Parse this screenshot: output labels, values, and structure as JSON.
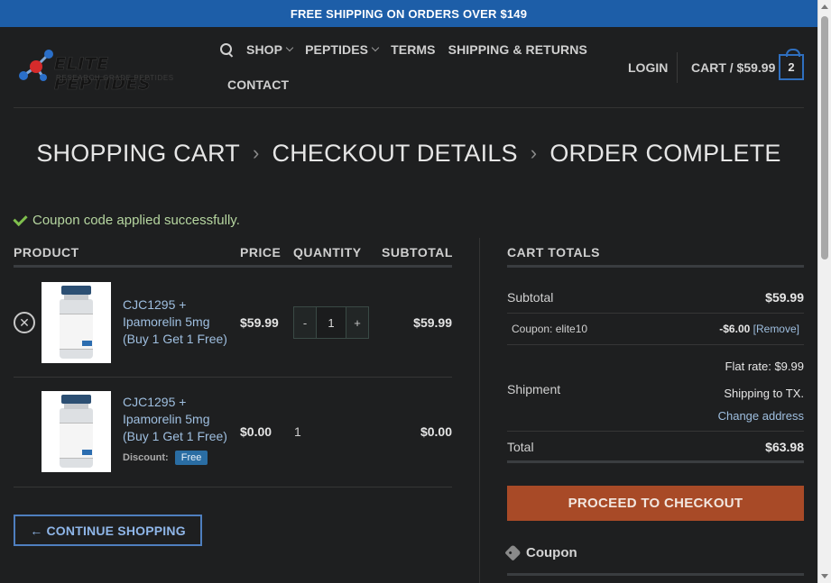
{
  "topbar": {
    "text": "FREE SHIPPING ON ORDERS OVER $149"
  },
  "logo": {
    "name": "ELITE PEPTIDES",
    "tagline": "RESEARCH GRADE PEPTIDES"
  },
  "nav": {
    "items": [
      {
        "label": "SHOP"
      },
      {
        "label": "PEPTIDES"
      },
      {
        "label": "TERMS"
      },
      {
        "label": "SHIPPING & RETURNS"
      },
      {
        "label": "CONTACT"
      }
    ],
    "login": "LOGIN",
    "cart_label": "CART / $59.99",
    "cart_count": "2"
  },
  "steps": [
    "SHOPPING CART",
    "CHECKOUT DETAILS",
    "ORDER COMPLETE"
  ],
  "notice": "Coupon code applied successfully.",
  "table": {
    "headers": {
      "product": "PRODUCT",
      "price": "PRICE",
      "quantity": "QUANTITY",
      "subtotal": "SUBTOTAL"
    },
    "rows": [
      {
        "remove": "✕",
        "name": "CJC1295 + Ipamorelin 5mg (Buy 1 Get 1 Free)",
        "price": "$59.99",
        "qty": "1",
        "subtotal": "$59.99"
      },
      {
        "name": "CJC1295 + Ipamorelin 5mg (Buy 1 Get 1 Free)",
        "price": "$0.00",
        "qty": "1",
        "subtotal": "$0.00",
        "discount_label": "Discount:",
        "discount_badge": "Free"
      }
    ],
    "qty_minus": "-",
    "qty_plus": "+"
  },
  "continue_btn": "← CONTINUE SHOPPING",
  "cart_totals": {
    "title": "CART TOTALS",
    "subtotal_label": "Subtotal",
    "subtotal_value": "$59.99",
    "coupon_label": "Coupon: elite10",
    "coupon_value": "-$6.00",
    "coupon_remove": "[Remove]",
    "shipment_label": "Shipment",
    "flat_rate": "Flat rate: $9.99",
    "shipping_to": "Shipping to TX.",
    "change_address": "Change address",
    "total_label": "Total",
    "total_value": "$63.98",
    "checkout_btn": "PROCEED TO CHECKOUT",
    "coupon_heading": "Coupon"
  },
  "colors": {
    "accent_blue": "#1d5ea8",
    "checkout_orange": "#a84a27",
    "success_green": "#7fbf4d"
  }
}
